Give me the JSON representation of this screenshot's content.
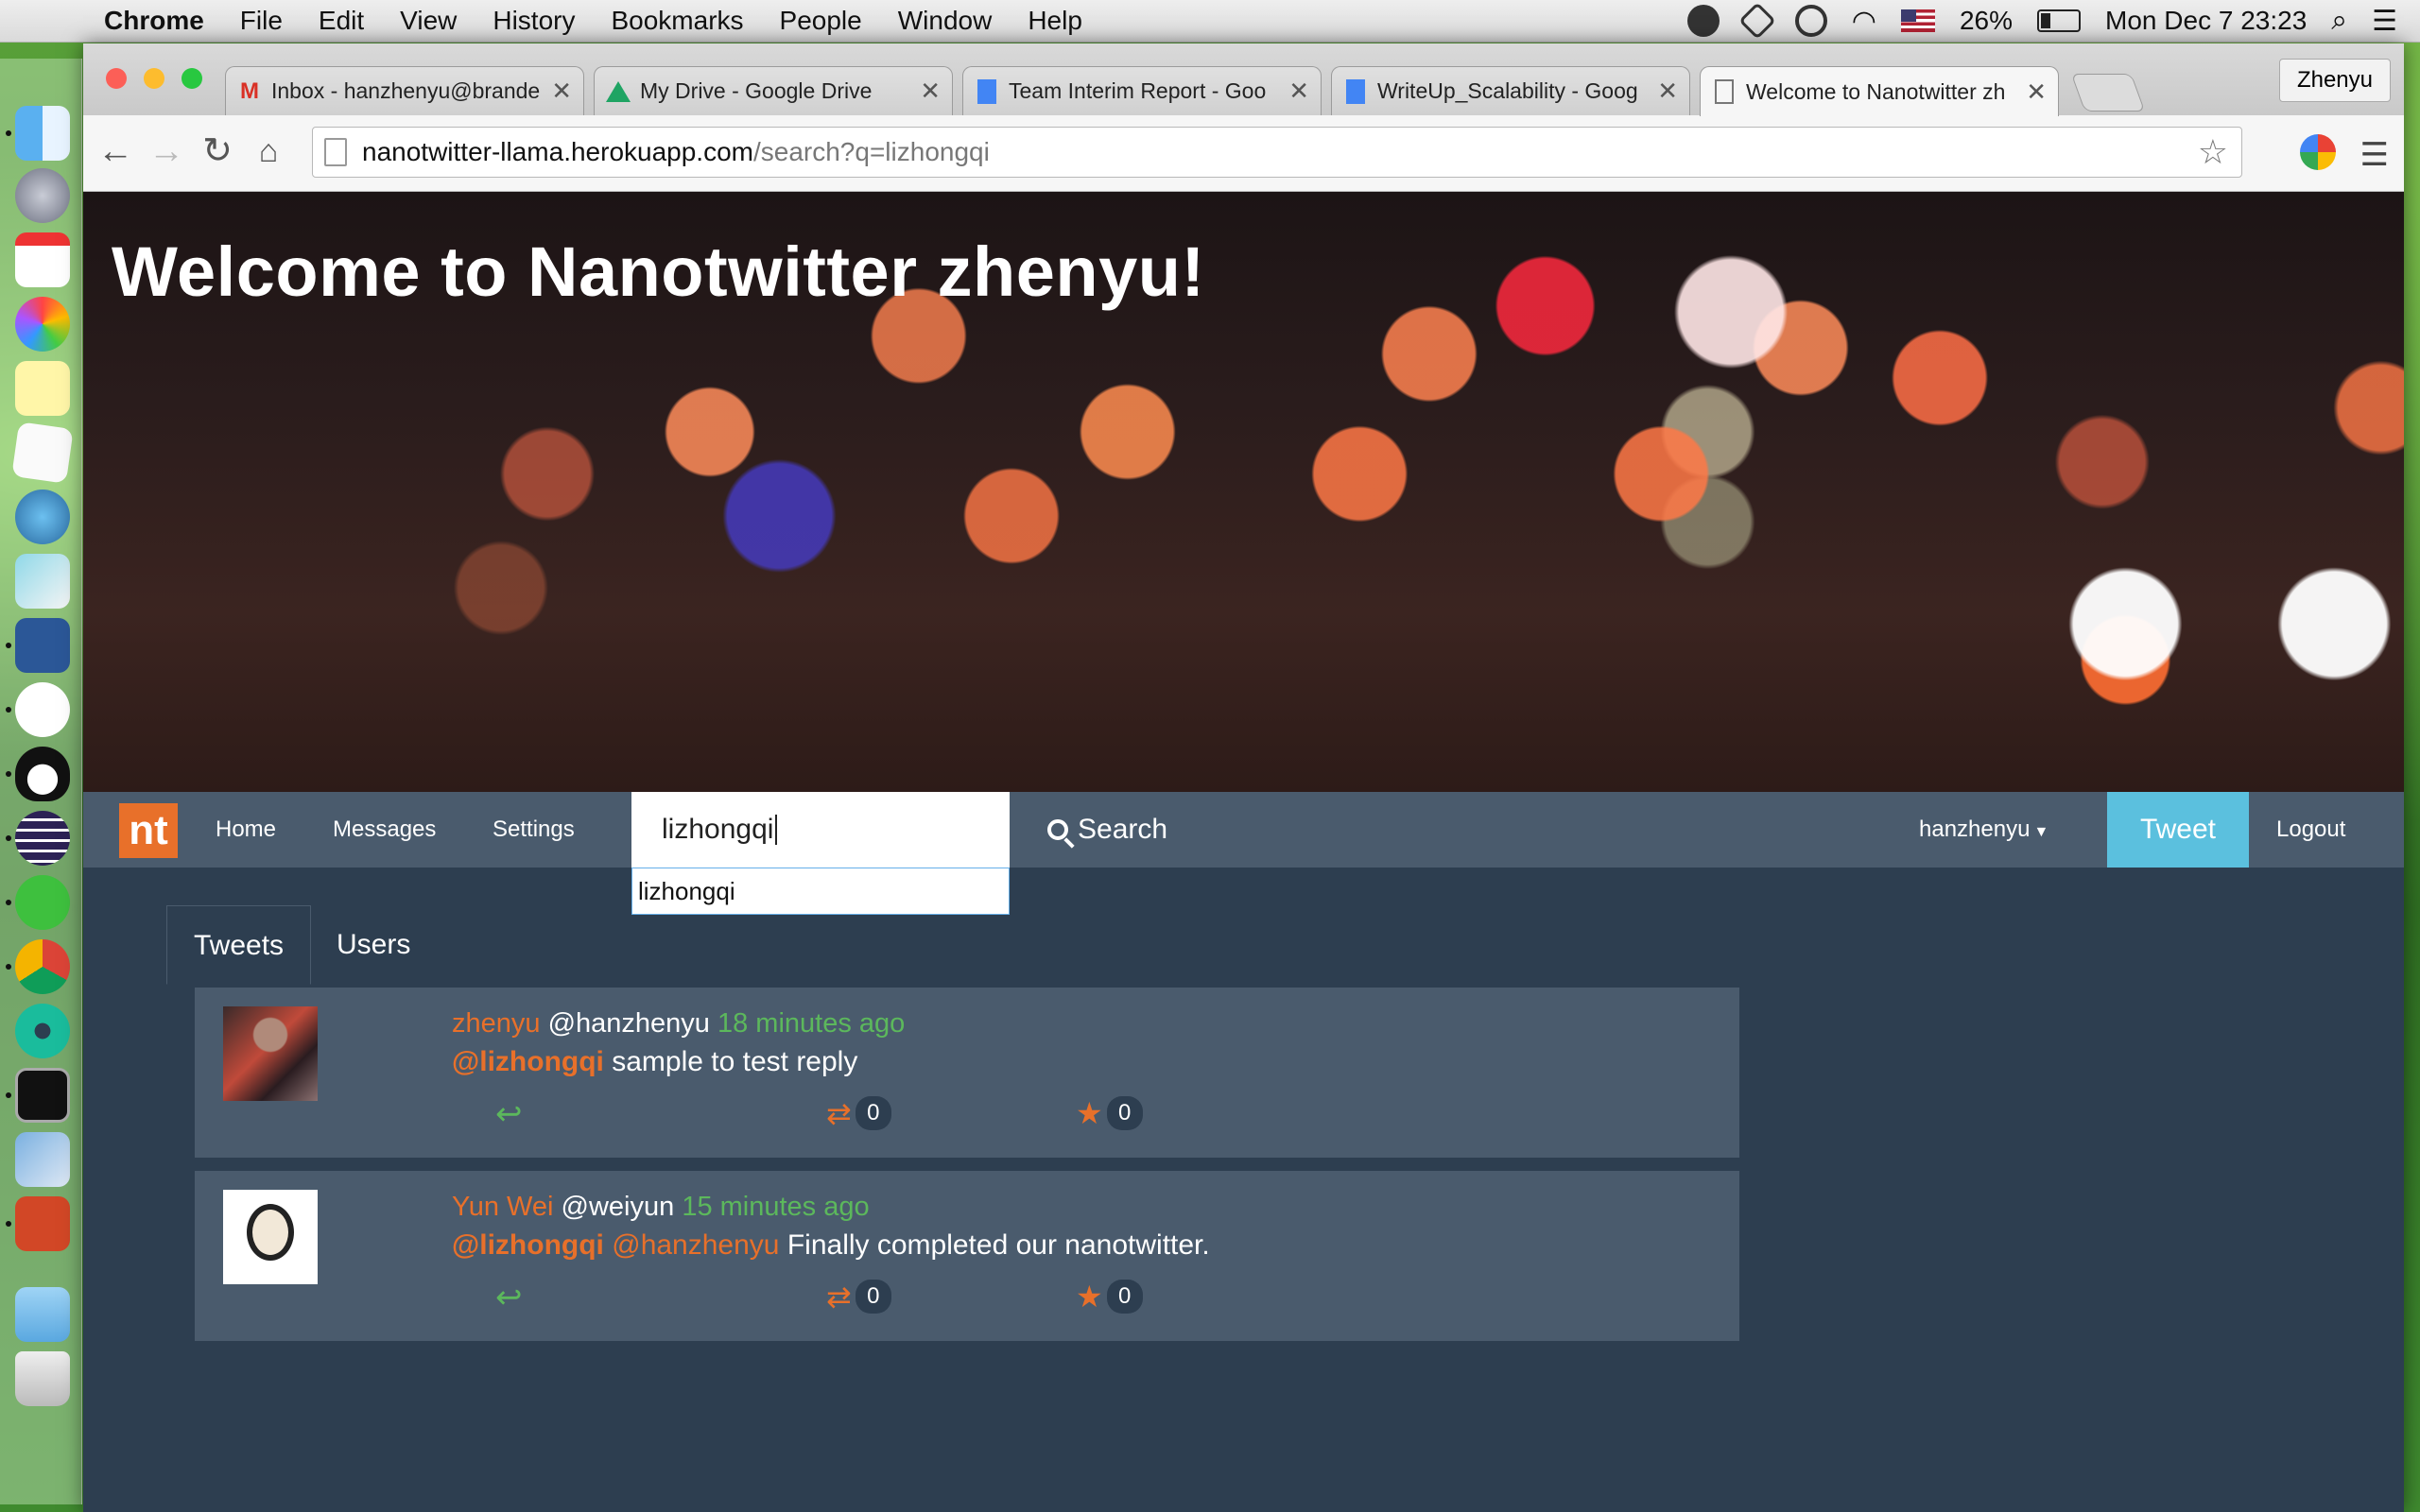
{
  "menubar": {
    "app": "Chrome",
    "items": [
      "File",
      "Edit",
      "View",
      "History",
      "Bookmarks",
      "People",
      "Window",
      "Help"
    ],
    "battery": "26%",
    "clock": "Mon Dec 7  23:23"
  },
  "browser": {
    "tabs": [
      {
        "title": "Inbox - hanzhenyu@brande",
        "icon": "gmail-icon"
      },
      {
        "title": "My Drive - Google Drive",
        "icon": "google-drive-icon"
      },
      {
        "title": "Team Interim Report - Goo",
        "icon": "google-docs-icon"
      },
      {
        "title": "WriteUp_Scalability - Goog",
        "icon": "google-docs-icon"
      },
      {
        "title": "Welcome to Nanotwitter zh",
        "icon": "page-icon"
      }
    ],
    "profile": "Zhenyu",
    "url_host": "nanotwitter-llama.herokuapp.com",
    "url_path": "/search?q=lizhongqi"
  },
  "page": {
    "heading": "Welcome to Nanotwitter zhenyu!",
    "nav": {
      "logo": "nt",
      "home": "Home",
      "messages": "Messages",
      "settings": "Settings",
      "search_value": "lizhongqi",
      "search_button": "Search",
      "autocomplete": "lizhongqi",
      "user": "hanzhenyu",
      "tweet": "Tweet",
      "logout": "Logout"
    },
    "tabs": [
      "Tweets",
      "Users"
    ],
    "tweets": [
      {
        "name": "zhenyu",
        "handle": "@hanzhenyu",
        "time": "18 minutes ago",
        "mention": "@lizhongqi",
        "mention2": "",
        "text": " sample to test reply",
        "retweets": "0",
        "favorites": "0"
      },
      {
        "name": "Yun Wei",
        "handle": "@weiyun",
        "time": "15 minutes ago",
        "mention": "@lizhongqi",
        "mention2": "@hanzhenyu",
        "text": "Finally completed our nanotwitter.",
        "retweets": "0",
        "favorites": "0"
      }
    ]
  },
  "colors": {
    "accent_orange": "#e8702a",
    "nav_bg": "#4a5b6d",
    "page_bg": "#2d3e50",
    "tweet_button": "#5bc0de",
    "time_green": "#5cb85c"
  }
}
